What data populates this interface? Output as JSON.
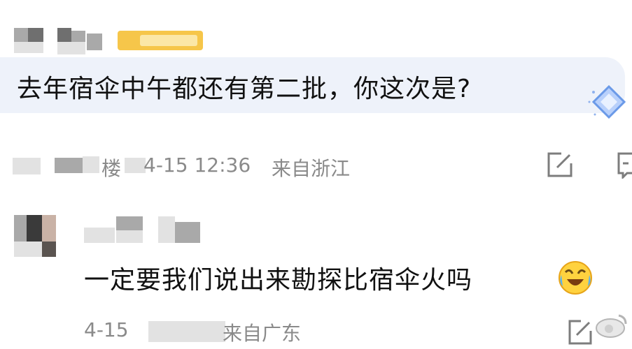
{
  "comments": [
    {
      "text": "去年宿伞中午都还有第二批，你这次是?",
      "meta_time": "4-15 12:36",
      "meta_location": "来自浙江",
      "floor_fragment": "楼"
    },
    {
      "text": "一定要我们说出来勘探比宿伞火吗",
      "meta_date": "4-15",
      "meta_location": "来自广东"
    }
  ],
  "icons": {
    "vip": "diamond-badge-icon",
    "edit": "edit-icon",
    "reply": "comment-icon",
    "emoji": "laughing-crying-emoji-icon",
    "watermark": "weibo-watermark-icon"
  },
  "colors": {
    "bubble": "#eef2fa",
    "meta": "#8a8a8a",
    "badge": "#f6c64a"
  }
}
